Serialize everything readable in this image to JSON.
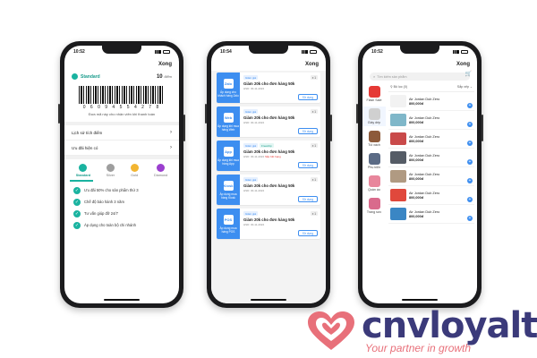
{
  "status": {
    "time1": "10:52",
    "time2": "10:54",
    "time3": "10:52"
  },
  "done_label": "Xong",
  "loyalty": {
    "tier": "Standard",
    "points_value": "10",
    "points_unit": "điểm",
    "barcode_number": "0 6 0 9 4 5 5 4 2 7 8",
    "barcode_note": "Đưa mã này cho nhân viên khi thanh toán",
    "links": [
      {
        "label": "Lịch sử tích điểm"
      },
      {
        "label": "Ưu đãi hiện có"
      }
    ],
    "tiers": [
      "Standard",
      "Silver",
      "Gold",
      "Diamond"
    ],
    "tier_colors": [
      "#1ab3a0",
      "#9e9e9e",
      "#f2b531",
      "#9b3fcf"
    ],
    "benefits": [
      "Ưu đãi 50% cho sản phẩm thứ 3",
      "Chế độ bảo hành 3 năm",
      "Tư vấn giúp đỡ 24/7",
      "Áp dụng cho toàn bộ chi nhánh"
    ]
  },
  "vouchers": [
    {
      "logo": "Zalo",
      "left_text": "Áp dụng cho khách hàng Zalo",
      "tags": [
        "Giảm giá"
      ],
      "title": "Giảm 20k cho đơn hàng 50k",
      "expiry": "HSD: 30-11-2022",
      "warn": "",
      "qty": "x 1",
      "button": "Sử dụng"
    },
    {
      "logo": "Web",
      "left_text": "Áp dụng khi mua hàng Web",
      "tags": [
        "Giảm giá"
      ],
      "title": "Giảm 20k cho đơn hàng 50k",
      "expiry": "HSD: 30-11-2022",
      "warn": "",
      "qty": "x 1",
      "button": "Sử dụng"
    },
    {
      "logo": "App",
      "left_text": "Áp dụng khi mua hàng App",
      "tags": [
        "Giảm giá",
        "Freeship"
      ],
      "title": "Giảm 20k cho đơn hàng 50k",
      "expiry": "HSD: 30-11-2022",
      "warn": "Sắp hết hạng",
      "qty": "x 1",
      "button": "Sử dụng"
    },
    {
      "logo": "Kiosk",
      "left_text": "Áp dụng mua hàng Kiosk",
      "tags": [
        "Giảm giá"
      ],
      "title": "Giảm 20k cho đơn hàng 50k",
      "expiry": "HSD: 30-11-2022",
      "warn": "",
      "qty": "x 1",
      "button": "Sử dụng"
    },
    {
      "logo": "POS",
      "left_text": "Áp dụng mua hàng POS",
      "tags": [
        "Giảm giá"
      ],
      "title": "Giảm 20k cho đơn hàng 50k",
      "expiry": "HSD: 30-11-2022",
      "warn": "",
      "qty": "x 1",
      "button": "Sử dụng"
    }
  ],
  "shop": {
    "search_placeholder": "Tìm kiếm sản phẩm",
    "filter_label": "Bộ lọc (0)",
    "sort_label": "Sắp xếp",
    "categories": [
      {
        "label": "Flash Sale",
        "color": "#e53935"
      },
      {
        "label": "Giày dép",
        "color": "#d0d0d0"
      },
      {
        "label": "Túi xách",
        "color": "#8d5a3a"
      },
      {
        "label": "Phụ kiện",
        "color": "#5b6b85"
      },
      {
        "label": "Quần áo",
        "color": "#e8869c"
      },
      {
        "label": "Trang sức",
        "color": "#d96a8c"
      }
    ],
    "products": [
      {
        "name": "Air Jordan Dub Zero",
        "price": "800,000đ",
        "color": "#f2f2f2"
      },
      {
        "name": "Air Jordan Dub Zero",
        "price": "800,000đ",
        "color": "#7fb7c9"
      },
      {
        "name": "Air Jordan Dub Zero",
        "price": "800,000đ",
        "color": "#c94a4a"
      },
      {
        "name": "Air Jordan Dub Zero",
        "price": "800,000đ",
        "color": "#555c66"
      },
      {
        "name": "Air Jordan Dub Zero",
        "price": "800,000đ",
        "color": "#b09a82"
      },
      {
        "name": "Air Jordan Dub Zero",
        "price": "800,000đ",
        "color": "#e0483c"
      },
      {
        "name": "Air Jordan Dub Zero",
        "price": "800,000đ",
        "color": "#3a86c4"
      }
    ]
  },
  "brand": {
    "name": "cnvloyalty",
    "slogan": "Your partner in growth",
    "heart_color": "#e8707a",
    "text_color": "#3b3a7a"
  }
}
